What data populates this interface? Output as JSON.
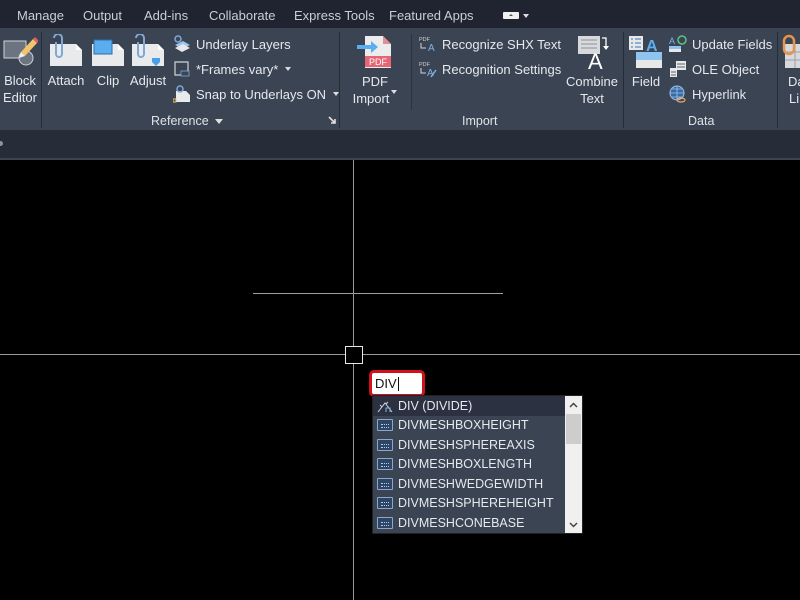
{
  "tabs": [
    "Manage",
    "Output",
    "Add-ins",
    "Collaborate",
    "Express Tools",
    "Featured Apps"
  ],
  "ribbon": {
    "block": {
      "block_editor": "Block\nEditor",
      "block_line1": "Block",
      "block_line2": "Editor"
    },
    "reference": {
      "title": "Reference",
      "attach": "Attach",
      "clip": "Clip",
      "adjust": "Adjust",
      "underlay_layers": "Underlay Layers",
      "frames": "*Frames vary*",
      "snap": "Snap to Underlays ON"
    },
    "import": {
      "title": "Import",
      "pdf_import_1": "PDF",
      "pdf_import_2": "Import",
      "recognize_shx": "Recognize SHX Text",
      "recognition_settings": "Recognition Settings",
      "combine_1": "Combine",
      "combine_2": "Text"
    },
    "data": {
      "title": "Data",
      "field": "Field",
      "update_fields": "Update Fields",
      "ole_object": "OLE Object",
      "hyperlink": "Hyperlink",
      "data_link_1": "Da",
      "data_link_2": "Lin"
    }
  },
  "command": {
    "input_value": "DIV",
    "accent": "#d1121a",
    "suggestions": [
      {
        "label": "DIV (DIVIDE)",
        "type": "command"
      },
      {
        "label": "DIVMESHBOXHEIGHT",
        "type": "sysvar"
      },
      {
        "label": "DIVMESHSPHEREAXIS",
        "type": "sysvar"
      },
      {
        "label": "DIVMESHBOXLENGTH",
        "type": "sysvar"
      },
      {
        "label": "DIVMESHWEDGEWIDTH",
        "type": "sysvar"
      },
      {
        "label": "DIVMESHSPHEREHEIGHT",
        "type": "sysvar"
      },
      {
        "label": "DIVMESHCONEBASE",
        "type": "sysvar"
      }
    ]
  }
}
